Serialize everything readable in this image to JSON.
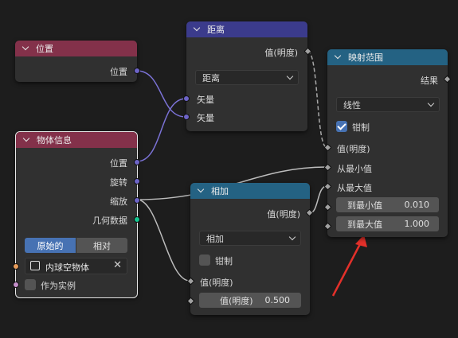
{
  "nodes": {
    "position": {
      "title": "位置",
      "out_position": "位置"
    },
    "distance": {
      "title": "距离",
      "out_value": "值(明度)",
      "mode": "距离",
      "in_vector1": "矢量",
      "in_vector2": "矢量"
    },
    "map_range": {
      "title": "映射范围",
      "out_result": "结果",
      "interpolation": "线性",
      "clamp_label": "钳制",
      "clamp_checked": true,
      "in_value": "值(明度)",
      "in_from_min": "从最小值",
      "in_from_max": "从最大值",
      "to_min_label": "到最小值",
      "to_min_value": "0.010",
      "to_max_label": "到最大值",
      "to_max_value": "1.000"
    },
    "object_info": {
      "title": "物体信息",
      "out_location": "位置",
      "out_rotation": "旋转",
      "out_scale": "缩放",
      "out_geometry": "几何数据",
      "tab_original": "原始的",
      "tab_relative": "相对",
      "object_name": "内球空物体",
      "as_instance": "作为实例"
    },
    "add": {
      "title": "相加",
      "out_value": "值(明度)",
      "operation": "相加",
      "clamp_label": "钳制",
      "clamp_checked": false,
      "in_value": "值(明度)",
      "field_label": "值(明度)",
      "field_value": "0.500"
    }
  },
  "colors": {
    "header_input": "#83314a",
    "header_vector": "#3b3b8c",
    "header_converter": "#246283",
    "socket_vector": "#6d64c7",
    "socket_geometry": "#13c58f",
    "annotation_arrow": "#e3302a"
  },
  "icons": [
    "chevron-down-icon",
    "dropdown-arrow-icon",
    "object-icon",
    "close-icon",
    "check-icon"
  ]
}
